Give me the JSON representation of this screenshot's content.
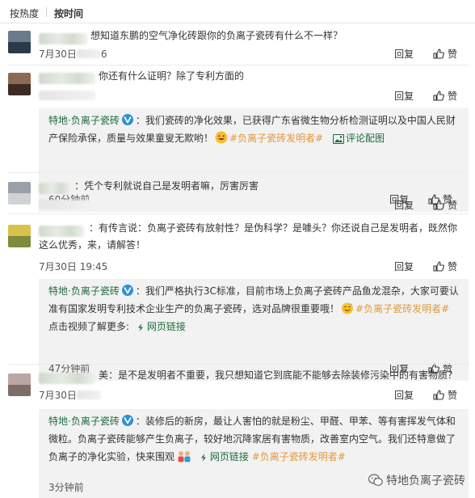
{
  "sort_tabs": {
    "hot": "按热度",
    "time": "按时间"
  },
  "labels": {
    "reply": "回复",
    "like": "赞",
    "comment_image": "评论配图",
    "web_link": "网页链接"
  },
  "colors": {
    "brand": "#1e6b3a",
    "tag": "#e3983b",
    "reply_bg": "#f2f2f2"
  },
  "comments": [
    {
      "text": "想知道东鹏的空气净化砖跟你的负离子瓷砖有什么不一样？",
      "time": "7月30日",
      "time_tail": "6"
    },
    {
      "text": "你还有什么证明？除了专利方面的",
      "reply": {
        "brand": "特地·负离子瓷砖",
        "text": "：我们瓷砖的净化效果，已获得广东省微生物分析检测证明以及中国人民财产保险承保，质量与效果童叟无欺哟！",
        "tag": "#负离子瓷砖发明者#",
        "time": "60分钟前"
      }
    },
    {
      "text": "：凭个专利就说自己是发明者嘛，厉害厉害"
    },
    {
      "text": "：有传言说：负离子瓷砖有放射性？是伪科学？是噱头？你还说自己是发明者，既然你这么优秀，来，请解答！",
      "time": "7月30日 19:45",
      "reply": {
        "brand": "特地·负离子瓷砖",
        "text": "：我们严格执行3C标准，目前市场上负离子瓷砖产品鱼龙混杂，大家可要认准有国家发明专利技术企业生产的负离子瓷砖，选对品牌很重要哦！",
        "tag": "#负离子瓷砖发明者#",
        "text2": " 点击视频了解更多:",
        "time": "47分钟前"
      }
    },
    {
      "text": "美：是不是发明者不重要，我只想知道它到底能不能够去除装修污染中的有害物质？",
      "time": "7月30日",
      "reply": {
        "brand": "特地·负离子瓷砖",
        "text": "：装修后的新房，最让人害怕的就是粉尘、甲醛、甲苯、等有害挥发气体和微粒。负离子瓷砖能够产生负离子，较好地沉降家居有害物质，改善室内空气。我们还特意做了负离子的净化实验，快来围观",
        "tag": "#负离子瓷砖发明者#",
        "time": "3分钟前"
      }
    }
  ],
  "watermark": "特地负离子瓷砖"
}
